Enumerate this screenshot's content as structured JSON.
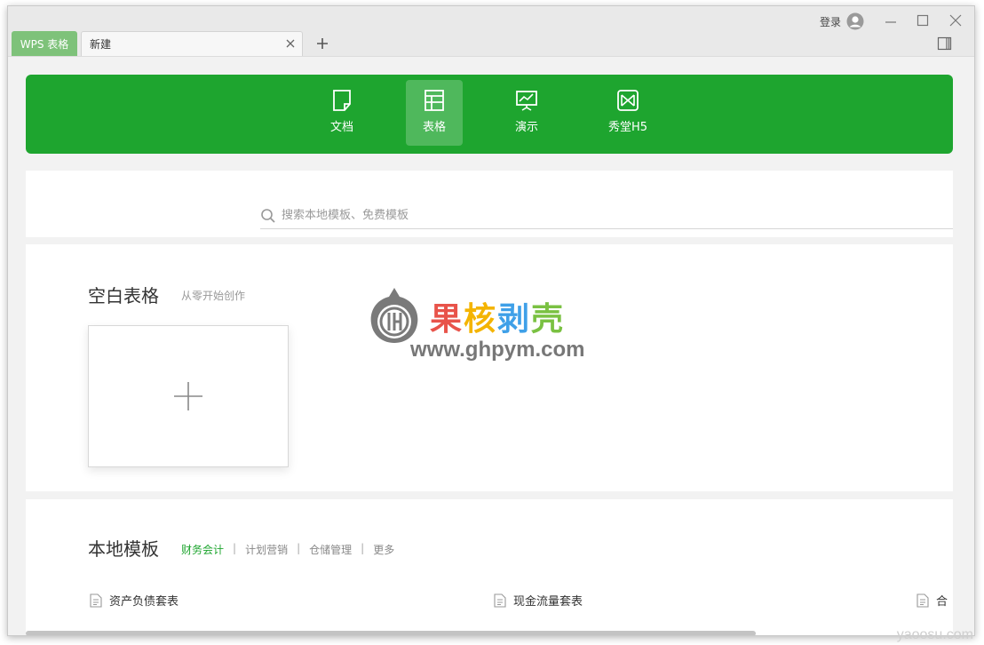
{
  "tabs": {
    "app": "WPS 表格",
    "current": "新建"
  },
  "topbar": {
    "login_label": "登录"
  },
  "categories": [
    {
      "label": "文档",
      "icon": "document-icon"
    },
    {
      "label": "表格",
      "icon": "table-icon",
      "active": true
    },
    {
      "label": "演示",
      "icon": "presentation-icon"
    },
    {
      "label": "秀堂H5",
      "icon": "h5-icon"
    }
  ],
  "search": {
    "placeholder": "搜索本地模板、免费模板"
  },
  "blank": {
    "title": "空白表格",
    "subtitle": "从零开始创作"
  },
  "watermark": {
    "brand": "果核剥壳",
    "url": "www.ghpym.com",
    "corner": "yaoosu.com"
  },
  "local_templates": {
    "title": "本地模板",
    "filters": [
      "财务会计",
      "计划营销",
      "仓储管理",
      "更多"
    ],
    "items": [
      "资产负债套表",
      "现金流量套表",
      "合"
    ]
  },
  "colors": {
    "accent": "#1ea52f",
    "app_tab": "#7ec27a",
    "brand_1": "#e8534a",
    "brand_2": "#f4b400",
    "brand_3": "#3fa0e8",
    "brand_4": "#7ac142"
  }
}
